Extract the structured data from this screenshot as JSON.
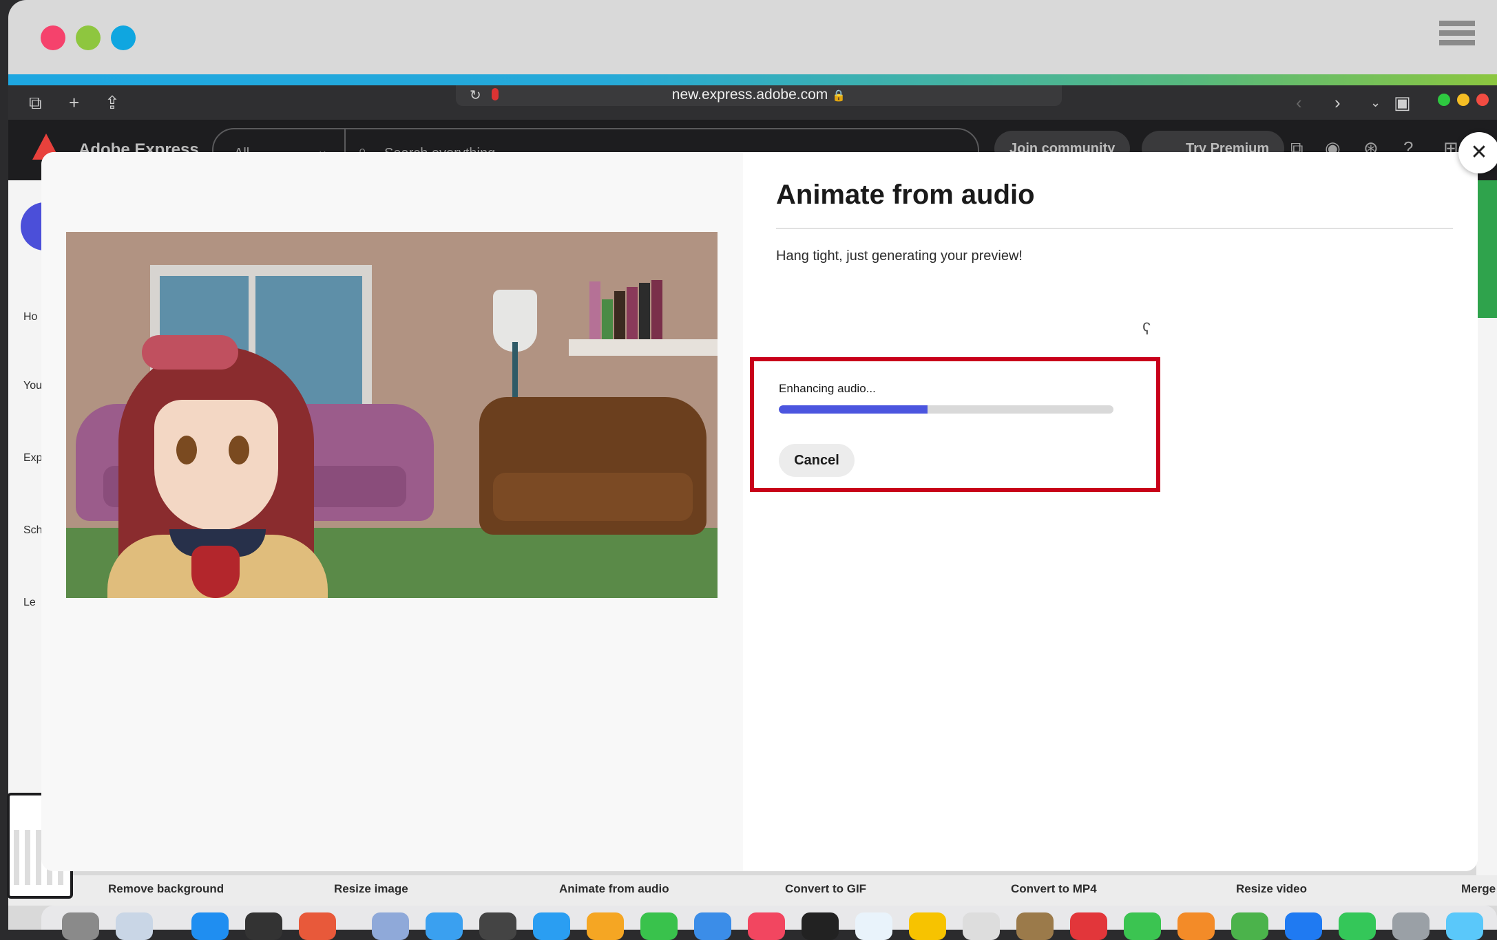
{
  "browser": {
    "url": "new.express.adobe.com"
  },
  "app": {
    "name": "Adobe Express",
    "search_filter": "All",
    "search_placeholder": "Search everything",
    "join_community": "Join community",
    "try_premium": "Try Premium"
  },
  "left_rail": {
    "items": [
      "Ho",
      "You",
      "Exp",
      "Sch",
      "Le"
    ]
  },
  "modal": {
    "title": "Animate from audio",
    "status": "Hang tight, just generating your preview!",
    "progress_label": "Enhancing audio...",
    "progress_fraction": 0.445,
    "cancel_label": "Cancel",
    "close_icon": "close-icon"
  },
  "quick_actions": [
    "Remove background",
    "Resize image",
    "Animate from audio",
    "Convert to GIF",
    "Convert to MP4",
    "Resize video",
    "Merge"
  ],
  "colors": {
    "accent": "#4b55df",
    "highlight_border": "#c8001a"
  }
}
